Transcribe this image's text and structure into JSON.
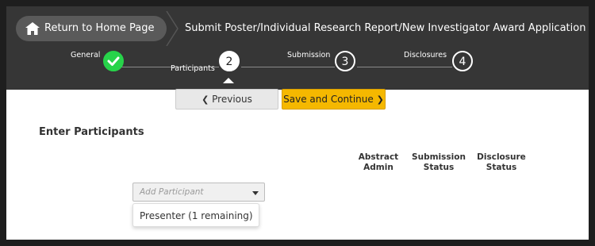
{
  "header": {
    "home_label": "Return to Home Page",
    "title": "Submit Poster/Individual Research Report/New Investigator Award Application"
  },
  "steps": [
    {
      "label": "General",
      "number": "",
      "state": "complete"
    },
    {
      "label": "Participants",
      "number": "2",
      "state": "active"
    },
    {
      "label": "Submission",
      "number": "3",
      "state": "todo"
    },
    {
      "label": "Disclosures",
      "number": "4",
      "state": "todo"
    }
  ],
  "nav": {
    "previous_label": "Previous",
    "next_label": "Save and Continue"
  },
  "main": {
    "heading": "Enter Participants",
    "columns": [
      {
        "line1": "Abstract",
        "line2": "Admin"
      },
      {
        "line1": "Submission",
        "line2": "Status"
      },
      {
        "line1": "Disclosure",
        "line2": "Status"
      }
    ],
    "add_participant_placeholder": "Add Participant",
    "dropdown_options": [
      "Presenter (1 remaining)"
    ]
  },
  "colors": {
    "header_bg": "#363636",
    "accent_yellow": "#f5b800",
    "complete_green": "#27d34a"
  }
}
